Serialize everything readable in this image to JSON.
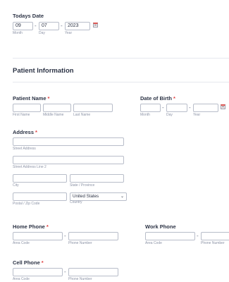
{
  "today": {
    "label": "Todays Date",
    "month": "09",
    "day": "07",
    "year": "2023",
    "sep": "-",
    "month_label": "Month",
    "day_label": "Day",
    "year_label": "Year"
  },
  "patient": {
    "section_title": "Patient Information",
    "name": {
      "label": "Patient Name",
      "req": "*",
      "first": "First Name",
      "middle": "Middle Name",
      "last": "Last Name"
    },
    "dob": {
      "label": "Date of Birth",
      "req": "*",
      "sep": "-",
      "month": "Month",
      "day": "Day",
      "year": "Year"
    },
    "address": {
      "label": "Address",
      "req": "*",
      "street": "Street Address",
      "street2": "Street Address Line 2",
      "city": "City",
      "state": "State / Province",
      "postal": "Postal / Zip Code",
      "country": "Country",
      "country_value": "United States"
    },
    "home_phone": {
      "label": "Home Phone",
      "req": "*",
      "sep": "-",
      "area": "Area Code",
      "number": "Phone Number"
    },
    "work_phone": {
      "label": "Work Phone",
      "sep": "-",
      "area": "Area Code",
      "number": "Phone Number"
    },
    "cell_phone": {
      "label": "Cell Phone",
      "req": "*",
      "sep": "-",
      "area": "Area Code",
      "number": "Phone Number"
    }
  },
  "icons": {
    "calendar": "calendar-icon",
    "chevron": "chevron-down-icon"
  }
}
